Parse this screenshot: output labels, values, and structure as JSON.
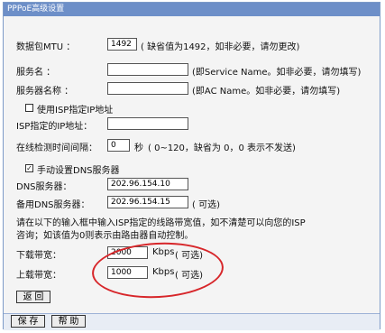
{
  "title": "PPPoE高级设置",
  "mtu": {
    "label": "数据包MTU ：",
    "value": "1492",
    "hint": "( 缺省值为1492，如非必要，请勿更改)"
  },
  "service_name": {
    "label": "服务名 ：",
    "value": "",
    "hint": "(即Service Name。如非必要，请勿填写)"
  },
  "server_name": {
    "label": "服务器名称 ：",
    "value": "",
    "hint": "(即AC Name。如非必要，请勿填写)"
  },
  "isp_ip": {
    "checkbox_label": "使用ISP指定IP地址",
    "checked": false,
    "label": "ISP指定的IP地址：",
    "value": ""
  },
  "detect": {
    "label": "在线检测时间间隔：",
    "value": "0",
    "unit": "秒",
    "hint": "( 0~120，缺省为 0，0 表示不发送)"
  },
  "dns": {
    "checkbox_label": "手动设置DNS服务器",
    "checked": true,
    "primary_label": "DNS服务器：",
    "primary_value": "202.96.154.10",
    "secondary_label": "备用DNS服务器：",
    "secondary_value": "202.96.154.15",
    "optional": "( 可选)"
  },
  "note_lines": [
    "请在以下的输入框中输入ISP指定的线路带宽值，如不清楚可以向您的ISP",
    "咨询；如该值为0则表示由路由器自动控制。"
  ],
  "bandwidth": {
    "down_label": "下载带宽：",
    "down_value": "2000",
    "up_label": "上载带宽：",
    "up_value": "1000",
    "unit": "Kbps",
    "optional": "( 可选)"
  },
  "buttons": {
    "back": "返 回",
    "save": "保 存",
    "help": "帮 助"
  },
  "colors": {
    "titlebar": "#6d8fc8",
    "annotation": "#d7262a"
  }
}
